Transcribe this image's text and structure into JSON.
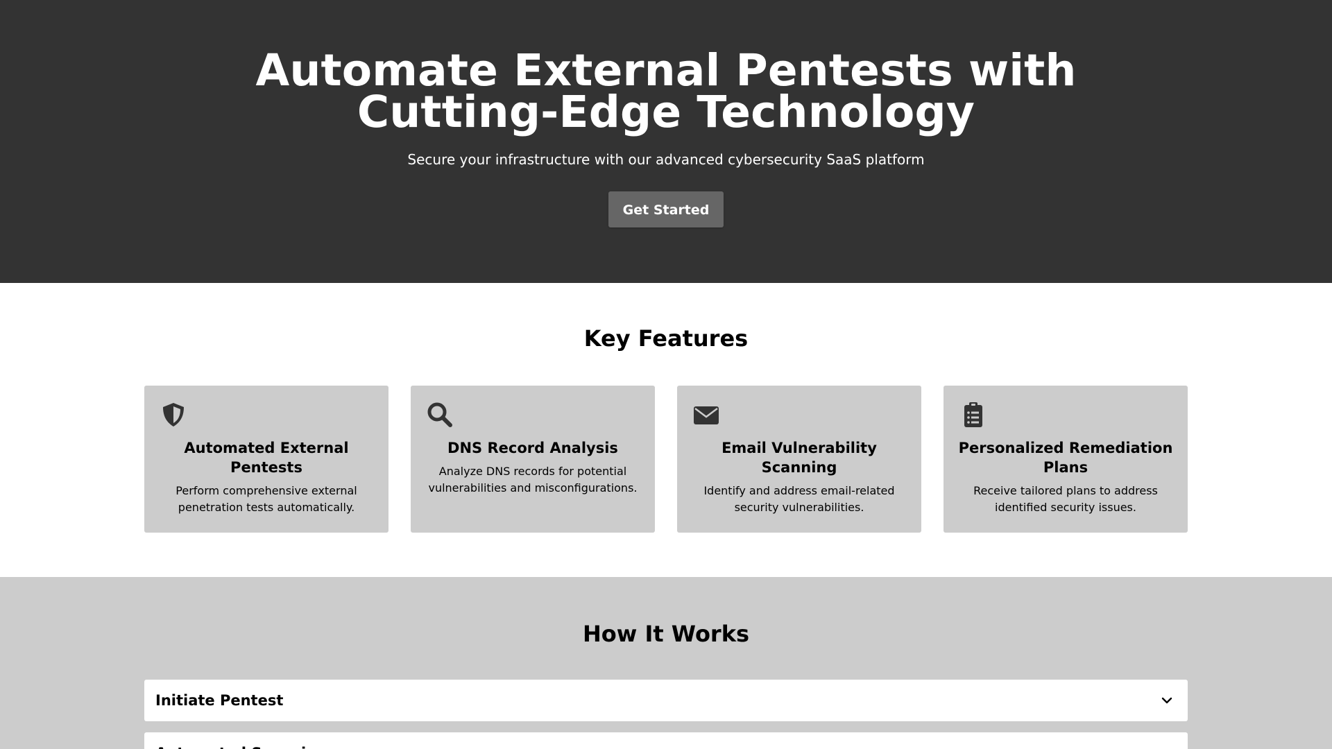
{
  "hero": {
    "title": "Automate External Pentests with Cutting-Edge Technology",
    "subtitle": "Secure your infrastructure with our advanced cybersecurity SaaS platform",
    "cta_label": "Get Started"
  },
  "features": {
    "heading": "Key Features",
    "items": [
      {
        "icon": "shield-icon",
        "title": "Automated External Pentests",
        "description": "Perform comprehensive external penetration tests automatically."
      },
      {
        "icon": "search-icon",
        "title": "DNS Record Analysis",
        "description": "Analyze DNS records for potential vulnerabilities and misconfigurations."
      },
      {
        "icon": "envelope-icon",
        "title": "Email Vulnerability Scanning",
        "description": "Identify and address email-related security vulnerabilities."
      },
      {
        "icon": "clipboard-list-icon",
        "title": "Personalized Remediation Plans",
        "description": "Receive tailored plans to address identified security issues."
      }
    ]
  },
  "how_it_works": {
    "heading": "How It Works",
    "steps": [
      {
        "title": "Initiate Pentest"
      },
      {
        "title": "Automated Scanning"
      }
    ]
  },
  "colors": {
    "hero_bg": "#333333",
    "button_bg": "#666666",
    "card_bg": "#cccccc",
    "section_bg": "#cccccc",
    "text_light": "#ffffff",
    "text_dark": "#000000"
  }
}
